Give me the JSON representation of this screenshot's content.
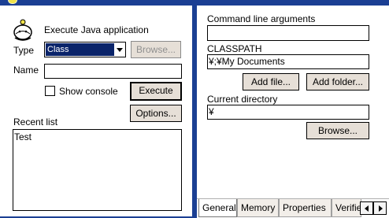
{
  "left": {
    "app_title": "Execute Java application",
    "type_label": "Type",
    "type_value": "Class",
    "browse_label": "Browse...",
    "name_label": "Name",
    "name_value": "",
    "show_console_label": "Show console",
    "show_console_checked": false,
    "execute_label": "Execute",
    "options_label": "Options...",
    "recent_list_label": "Recent list",
    "recent_items": [
      "Test"
    ]
  },
  "right": {
    "cmd_args_label": "Command line arguments",
    "cmd_args_value": "",
    "classpath_label": "CLASSPATH",
    "classpath_value": "¥;¥My Documents",
    "add_file_label": "Add file...",
    "add_folder_label": "Add folder...",
    "current_dir_label": "Current directory",
    "current_dir_value": "¥",
    "browse_label": "Browse...",
    "tabs": [
      "General",
      "Memory",
      "Properties",
      "Verifie"
    ]
  },
  "colors": {
    "titlebar": "#1b3f93",
    "button_face": "#e6dfd7",
    "selection": "#0a246a",
    "icon_yellow": "#f0e24a"
  },
  "icons": [
    "duke-icon",
    "dropdown-arrow-icon",
    "scroll-left-icon",
    "scroll-right-icon"
  ]
}
